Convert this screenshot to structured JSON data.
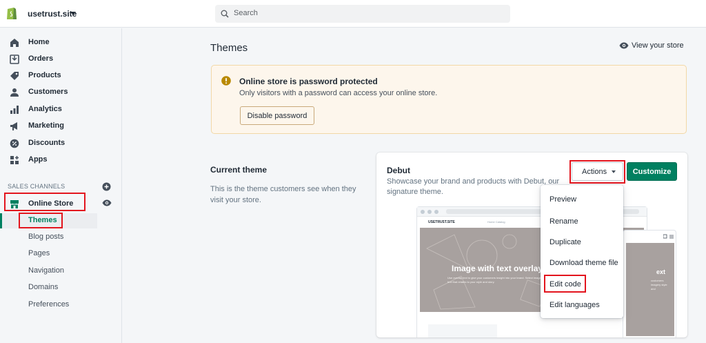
{
  "topbar": {
    "store_name": "usetrust.site",
    "search_placeholder": "Search"
  },
  "sidebar": {
    "items": [
      {
        "label": "Home",
        "icon": "home-icon"
      },
      {
        "label": "Orders",
        "icon": "orders-icon"
      },
      {
        "label": "Products",
        "icon": "tag-icon"
      },
      {
        "label": "Customers",
        "icon": "person-icon"
      },
      {
        "label": "Analytics",
        "icon": "bar-chart-icon"
      },
      {
        "label": "Marketing",
        "icon": "megaphone-icon"
      },
      {
        "label": "Discounts",
        "icon": "discount-icon"
      },
      {
        "label": "Apps",
        "icon": "apps-icon"
      }
    ],
    "section_title": "SALES CHANNELS",
    "channel": "Online Store",
    "sub_items": [
      "Themes",
      "Blog posts",
      "Pages",
      "Navigation",
      "Domains",
      "Preferences"
    ]
  },
  "main": {
    "title": "Themes",
    "view_store": "View your store",
    "banner": {
      "title": "Online store is password protected",
      "text": "Only visitors with a password can access your online store.",
      "button": "Disable password"
    },
    "current_theme": {
      "title": "Current theme",
      "description": "This is the theme customers see when they visit your store."
    },
    "theme_card": {
      "name": "Debut",
      "description": "Showcase your brand and products with Debut, our signature theme.",
      "actions_label": "Actions",
      "customize_label": "Customize",
      "preview": {
        "store": "USETRUST.SITE",
        "nav": "Home  Catalog",
        "hero_title": "Image with text overlay",
        "hero_sub": "Use overlay text to give your customers insight into your brand. Select imagery and text that relates to your style and story.",
        "mobile_title": "ext",
        "mobile_sub": "customers imagery style and"
      }
    },
    "actions_menu": [
      "Preview",
      "Rename",
      "Duplicate",
      "Download theme file",
      "Edit code",
      "Edit languages"
    ]
  },
  "colors": {
    "accent_green": "#008060",
    "highlight_red": "#e3141d",
    "banner_bg": "#fdf6ec",
    "warning_icon": "#b98900"
  }
}
